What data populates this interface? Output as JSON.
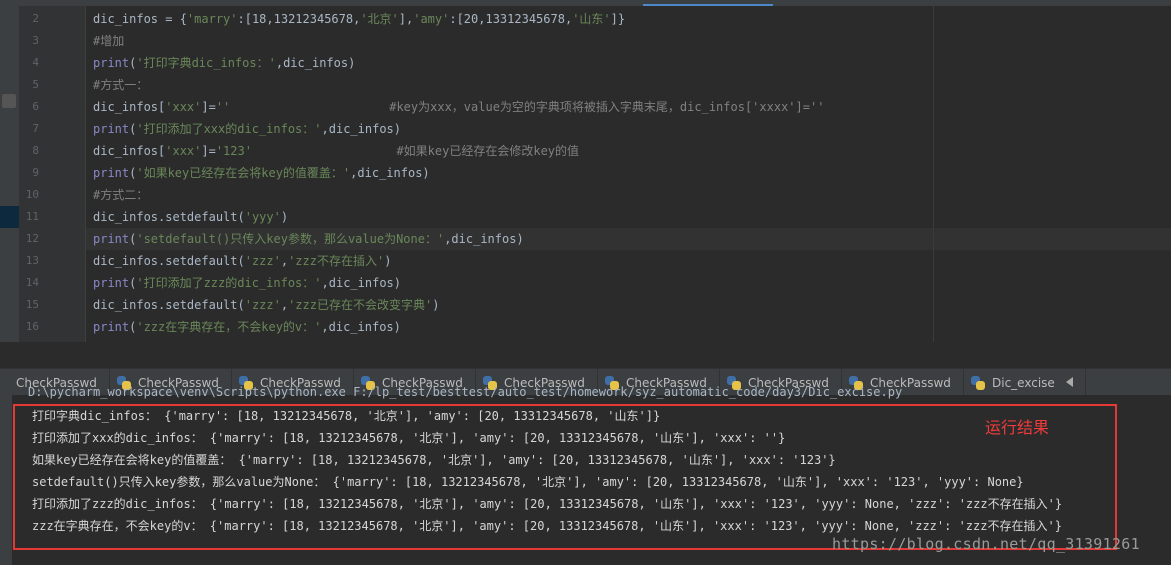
{
  "editor": {
    "lines": [
      {
        "num": "2",
        "parts": [
          {
            "t": "dic_infos = {",
            "c": "id"
          },
          {
            "t": "'marry'",
            "c": "str"
          },
          {
            "t": ":[18,13212345678,",
            "c": "id"
          },
          {
            "t": "'北京'",
            "c": "str"
          },
          {
            "t": "],",
            "c": "id"
          },
          {
            "t": "'amy'",
            "c": "str"
          },
          {
            "t": ":[20,13312345678,",
            "c": "id"
          },
          {
            "t": "'山东'",
            "c": "str"
          },
          {
            "t": "]}",
            "c": "id"
          }
        ]
      },
      {
        "num": "3",
        "parts": [
          {
            "t": "#增加",
            "c": "cmt"
          }
        ]
      },
      {
        "num": "4",
        "parts": [
          {
            "t": "print",
            "c": "kw"
          },
          {
            "t": "(",
            "c": "id"
          },
          {
            "t": "'打印字典dic_infos：'",
            "c": "str"
          },
          {
            "t": ",dic_infos)",
            "c": "id"
          }
        ]
      },
      {
        "num": "5",
        "parts": [
          {
            "t": "#方式一：",
            "c": "cmt"
          }
        ]
      },
      {
        "num": "6",
        "parts": [
          {
            "t": "dic_infos[",
            "c": "id"
          },
          {
            "t": "'xxx'",
            "c": "str"
          },
          {
            "t": "]=",
            "c": "id"
          },
          {
            "t": "''",
            "c": "str"
          },
          {
            "t": "                      ",
            "c": "id"
          },
          {
            "t": "#key为xxx，value为空的字典项将被插入字典末尾，dic_infos['xxxx']=''",
            "c": "cmt"
          }
        ]
      },
      {
        "num": "7",
        "parts": [
          {
            "t": "print",
            "c": "kw"
          },
          {
            "t": "(",
            "c": "id"
          },
          {
            "t": "'打印添加了xxx的dic_infos：'",
            "c": "str"
          },
          {
            "t": ",dic_infos)",
            "c": "id"
          }
        ]
      },
      {
        "num": "8",
        "parts": [
          {
            "t": "dic_infos[",
            "c": "id"
          },
          {
            "t": "'xxx'",
            "c": "str"
          },
          {
            "t": "]=",
            "c": "id"
          },
          {
            "t": "'123'",
            "c": "str"
          },
          {
            "t": "                    ",
            "c": "id"
          },
          {
            "t": "#如果key已经存在会修改key的值",
            "c": "cmt"
          }
        ]
      },
      {
        "num": "9",
        "parts": [
          {
            "t": "print",
            "c": "kw"
          },
          {
            "t": "(",
            "c": "id"
          },
          {
            "t": "'如果key已经存在会将key的值覆盖：'",
            "c": "str"
          },
          {
            "t": ",dic_infos)",
            "c": "id"
          }
        ]
      },
      {
        "num": "10",
        "parts": [
          {
            "t": "#方式二：",
            "c": "cmt"
          }
        ]
      },
      {
        "num": "11",
        "parts": [
          {
            "t": "dic_infos.setdefault(",
            "c": "id"
          },
          {
            "t": "'yyy'",
            "c": "str"
          },
          {
            "t": ")",
            "c": "id"
          }
        ]
      },
      {
        "num": "12",
        "parts": [
          {
            "t": "print",
            "c": "kw"
          },
          {
            "t": "(",
            "c": "id"
          },
          {
            "t": "'setdefault()只传入key参数，那么value为None：'",
            "c": "str"
          },
          {
            "t": ",dic_infos)",
            "c": "id"
          }
        ]
      },
      {
        "num": "13",
        "parts": [
          {
            "t": "dic_infos.setdefault(",
            "c": "id"
          },
          {
            "t": "'zzz'",
            "c": "str"
          },
          {
            "t": ",",
            "c": "id"
          },
          {
            "t": "'zzz不存在插入'",
            "c": "str"
          },
          {
            "t": ")",
            "c": "id"
          }
        ]
      },
      {
        "num": "14",
        "parts": [
          {
            "t": "print",
            "c": "kw"
          },
          {
            "t": "(",
            "c": "id"
          },
          {
            "t": "'打印添加了zzz的dic_infos：'",
            "c": "str"
          },
          {
            "t": ",dic_infos)",
            "c": "id"
          }
        ]
      },
      {
        "num": "15",
        "parts": [
          {
            "t": "dic_infos.setdefault(",
            "c": "id"
          },
          {
            "t": "'zzz'",
            "c": "str"
          },
          {
            "t": ",",
            "c": "id"
          },
          {
            "t": "'zzz已存在不会改变字典'",
            "c": "str"
          },
          {
            "t": ")",
            "c": "id"
          }
        ]
      },
      {
        "num": "16",
        "parts": [
          {
            "t": "print",
            "c": "kw"
          },
          {
            "t": "(",
            "c": "id"
          },
          {
            "t": "'zzz在字典存在，不会key的v：'",
            "c": "str"
          },
          {
            "t": ",dic_infos)",
            "c": "id"
          }
        ]
      }
    ]
  },
  "run_tabs": [
    {
      "label": "CheckPasswd"
    },
    {
      "label": "CheckPasswd"
    },
    {
      "label": "CheckPasswd"
    },
    {
      "label": "CheckPasswd"
    },
    {
      "label": "CheckPasswd"
    },
    {
      "label": "CheckPasswd"
    },
    {
      "label": "CheckPasswd"
    },
    {
      "label": "CheckPasswd"
    },
    {
      "label": "Dic_excise"
    }
  ],
  "console": {
    "command": "D:\\pycharm_workspace\\venv\\Scripts\\python.exe F:/lp_test/besttest/auto_test/homework/syz_automatic_code/day3/Dic_excise.py",
    "output": [
      "打印字典dic_infos： {'marry': [18, 13212345678, '北京'], 'amy': [20, 13312345678, '山东']}",
      "打印添加了xxx的dic_infos： {'marry': [18, 13212345678, '北京'], 'amy': [20, 13312345678, '山东'], 'xxx': ''}",
      "如果key已经存在会将key的值覆盖： {'marry': [18, 13212345678, '北京'], 'amy': [20, 13312345678, '山东'], 'xxx': '123'}",
      "setdefault()只传入key参数，那么value为None： {'marry': [18, 13212345678, '北京'], 'amy': [20, 13312345678, '山东'], 'xxx': '123', 'yyy': None}",
      "打印添加了zzz的dic_infos： {'marry': [18, 13212345678, '北京'], 'amy': [20, 13312345678, '山东'], 'xxx': '123', 'yyy': None, 'zzz': 'zzz不存在插入'}",
      "zzz在字典存在，不会key的v： {'marry': [18, 13212345678, '北京'], 'amy': [20, 13312345678, '山东'], 'xxx': '123', 'yyy': None, 'zzz': 'zzz不存在插入'}"
    ]
  },
  "annotation": {
    "result_label": "运行结果"
  },
  "watermark": "https://blog.csdn.net/qq_31391261",
  "colors": {
    "keyword": "#8888c6",
    "string": "#6a8759",
    "comment": "#808080",
    "highlight_box": "#e53935"
  }
}
